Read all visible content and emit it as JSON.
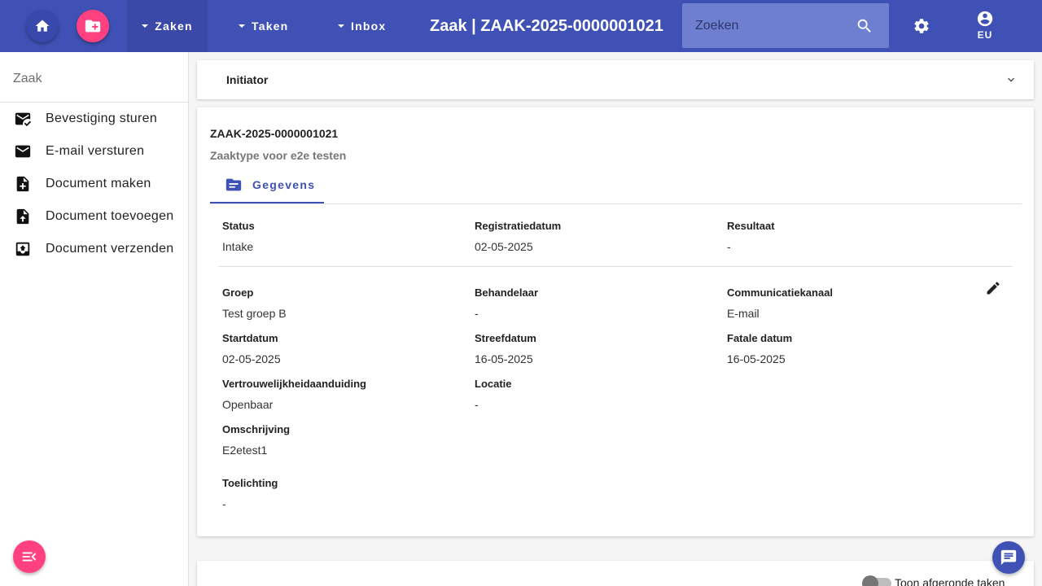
{
  "header": {
    "nav": [
      {
        "label": "Zaken"
      },
      {
        "label": "Taken"
      },
      {
        "label": "Inbox"
      }
    ],
    "title": "Zaak | ZAAK-2025-0000001021",
    "search_placeholder": "Zoeken",
    "user_initials": "EU",
    "color": "#3f51b5",
    "accent": "#ff4081"
  },
  "sidebar": {
    "title": "Zaak",
    "items": [
      {
        "label": "Bevestiging sturen",
        "icon": "mark-email-read-icon"
      },
      {
        "label": "E-mail versturen",
        "icon": "mail-icon"
      },
      {
        "label": "Document maken",
        "icon": "note-add-icon"
      },
      {
        "label": "Document toevoegen",
        "icon": "upload-file-icon"
      },
      {
        "label": "Document verzenden",
        "icon": "outbox-icon"
      }
    ]
  },
  "initiator": {
    "title": "Initiator"
  },
  "zaak": {
    "id": "ZAAK-2025-0000001021",
    "type": "Zaaktype voor e2e testen",
    "tab": "Gegevens",
    "fields": {
      "status": {
        "label": "Status",
        "value": "Intake"
      },
      "registratiedatum": {
        "label": "Registratiedatum",
        "value": "02-05-2025"
      },
      "resultaat": {
        "label": "Resultaat",
        "value": "-"
      },
      "groep": {
        "label": "Groep",
        "value": "Test groep B"
      },
      "behandelaar": {
        "label": "Behandelaar",
        "value": "-"
      },
      "communicatiekanaal": {
        "label": "Communicatiekanaal",
        "value": "E-mail"
      },
      "startdatum": {
        "label": "Startdatum",
        "value": "02-05-2025"
      },
      "streefdatum": {
        "label": "Streefdatum",
        "value": "16-05-2025"
      },
      "fatale_datum": {
        "label": "Fatale datum",
        "value": "16-05-2025"
      },
      "vertrouwelijkheid": {
        "label": "Vertrouwelijkheidaanduiding",
        "value": "Openbaar"
      },
      "locatie": {
        "label": "Locatie",
        "value": "-"
      },
      "omschrijving": {
        "label": "Omschrijving",
        "value": "E2etest1"
      },
      "toelichting": {
        "label": "Toelichting",
        "value": "-"
      }
    }
  },
  "taken": {
    "toggle_label": "Toon afgeronde taken"
  }
}
